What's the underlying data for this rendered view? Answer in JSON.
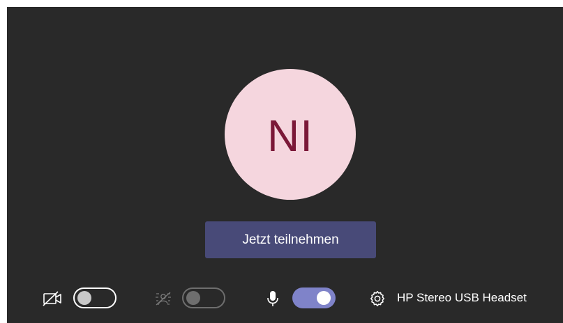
{
  "avatar": {
    "initials": "NI",
    "background": "#f5d6de",
    "text_color": "#7b1838"
  },
  "join_button": {
    "label": "Jetzt teilnehmen",
    "color": "#484a78"
  },
  "controls": {
    "camera": {
      "icon": "camera-off-icon",
      "toggle_state": "off"
    },
    "background_effects": {
      "icon": "background-blur-icon",
      "toggle_state": "disabled"
    },
    "microphone": {
      "icon": "microphone-icon",
      "toggle_state": "on",
      "accent": "#7f83c9"
    },
    "device_settings": {
      "icon": "gear-icon",
      "label": "HP Stereo USB Headset"
    }
  },
  "theme": {
    "background": "#292929"
  }
}
